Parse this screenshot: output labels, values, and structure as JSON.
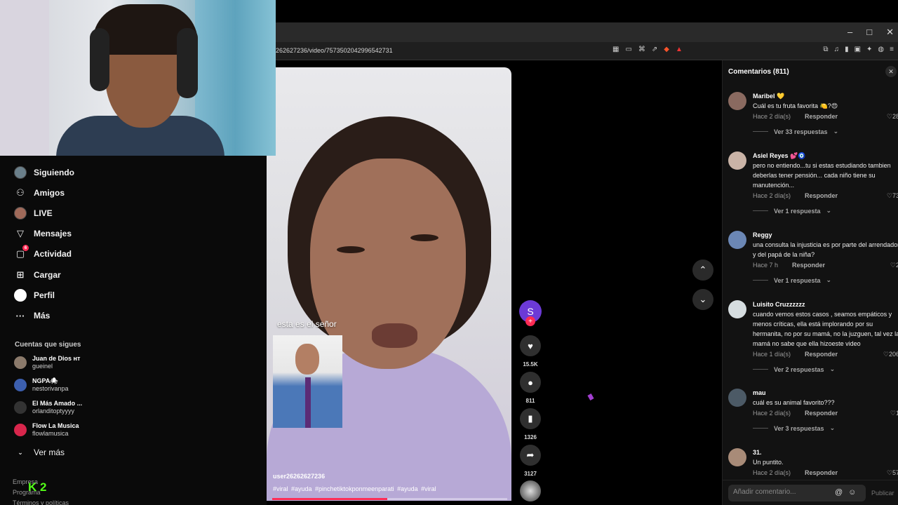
{
  "browser": {
    "url": "262627236/video/7573502042996542731",
    "window_controls": [
      "–",
      "□",
      "✕"
    ]
  },
  "sidebar": {
    "nav": [
      {
        "label": "Siguiendo",
        "icon": "following-avatar-icon"
      },
      {
        "label": "Amigos",
        "icon": "friends-icon"
      },
      {
        "label": "LIVE",
        "icon": "live-icon"
      },
      {
        "label": "Mensajes",
        "icon": "messages-icon"
      },
      {
        "label": "Actividad",
        "icon": "activity-icon",
        "badge": "6"
      },
      {
        "label": "Cargar",
        "icon": "upload-icon"
      },
      {
        "label": "Perfil",
        "icon": "profile-icon"
      },
      {
        "label": "Más",
        "icon": "more-icon"
      }
    ],
    "following_title": "Cuentas que sigues",
    "following": [
      {
        "name": "Juan de Dios ʜᴛ",
        "handle": "gueinel"
      },
      {
        "name": "NGPA🕷",
        "handle": "nestorivanpa"
      },
      {
        "name": "El Más Amado ...",
        "handle": "orlanditoptyyyy"
      },
      {
        "name": "Flow La Musica",
        "handle": "flowlamusica"
      }
    ],
    "see_more": "Ver más",
    "footer": [
      "Empresa",
      "Programa",
      "Términos y políticas"
    ],
    "kick_overlay": "2"
  },
  "video": {
    "overlay_text": "esta es el señor",
    "username": "user26262627236",
    "hashtags": "#viral #ayuda #pinchetiktokponmeenparati #ayuda #viral",
    "progress": 0.49
  },
  "actions": {
    "avatar_letter": "S",
    "likes": "15.5K",
    "comments": "811",
    "saves": "1326",
    "shares": "3127"
  },
  "comments_panel": {
    "title": "Comentarios (811)",
    "items": [
      {
        "name": "Maribel 💛",
        "text": "Cuál es tu fruta favorita 🍋?😍",
        "time": "Hace 2 día(s)",
        "reply": "Responder",
        "likes": "28",
        "replies": "Ver 33 respuestas"
      },
      {
        "name": "Asiel Reyes 💕🧿",
        "text": "pero no entiendo...tu si estas estudiando tambien deberlas tener pensión... cada niño tiene su manutención...",
        "time": "Hace 2 día(s)",
        "reply": "Responder",
        "likes": "73",
        "replies": "Ver 1 respuesta"
      },
      {
        "name": "Reggy",
        "text": "una consulta la injusticia es por parte del arrendador y del papá de la niña?",
        "time": "Hace 7 h",
        "reply": "Responder",
        "likes": "2",
        "replies": "Ver 1 respuesta"
      },
      {
        "name": "Luisito Cruzzzzzz",
        "text": "cuando vemos estos casos , seamos empáticos y menos críticas, ella está implorando por su hermanita, no por su mamá, no la juzguen, tal vez la mamá no sabe que ella hizoeste video",
        "time": "Hace 1 día(s)",
        "reply": "Responder",
        "likes": "206",
        "replies": "Ver 2 respuestas"
      },
      {
        "name": "mau",
        "text": "cuál es su animal favorito???",
        "time": "Hace 2 día(s)",
        "reply": "Responder",
        "likes": "1",
        "replies": "Ver 3 respuestas"
      },
      {
        "name": "31.",
        "text": "Un puntito.",
        "time": "Hace 2 día(s)",
        "reply": "Responder",
        "likes": "57",
        "replies": ""
      }
    ],
    "input_placeholder": "Añadir comentario...",
    "publish": "Publicar"
  }
}
